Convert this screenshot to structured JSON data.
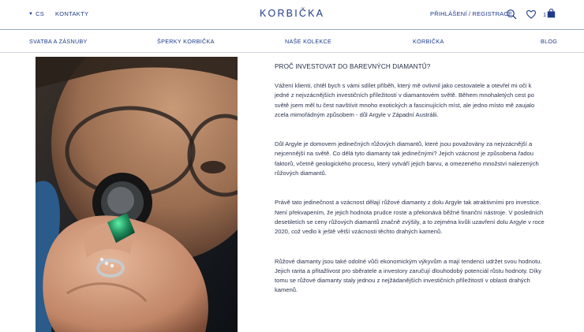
{
  "header": {
    "language": "CS",
    "contacts": "KONTAKTY",
    "logo": "KORBIČKA",
    "login": "PŘIHLÁŠENÍ / REGISTRACE",
    "cart_count": "1",
    "icons": [
      "search-icon",
      "heart-icon",
      "shopping-bag-icon"
    ]
  },
  "nav": {
    "items": [
      {
        "label": "SVATBA A ZÁSNUBY"
      },
      {
        "label": "ŠPERKY KORBIČKA"
      },
      {
        "label": "NAŠE KOLEKCE"
      },
      {
        "label": "KORBIČKA"
      },
      {
        "label": "BLOG"
      }
    ]
  },
  "article": {
    "title": "PROČ INVESTOVAT DO BAREVNÝCH DIAMANTŮ?",
    "paragraphs": [
      "Vážení klienti, chtěl bych s vámi sdílet příběh, který mě ovlivnil jako cestovatele a otevřel mi oči k jedné z nejvzácnějších investičních příležitostí v diamantovém světě. Během mnohaletých cest po světě jsem měl tu čest navštívit mnoho exotických a fascinujících míst, ale jedno místo mě zaujalo zcela mimořádným způsobem - důl Argyle v Západní Austrálii.",
      "Důl Argyle je domovem jedinečných růžových diamantů, které jsou považovány za nejvzácnější a nejcennější na světě. Co dělá tyto diamanty tak jedinečnými? Jejich vzácnost je způsobena řadou faktorů, včetně geologického procesu, který vytváří jejich barvu, a omezeného množství nalezených růžových diamantů.",
      "Právě tato jedinečnost a vzácnost dělají růžové diamanty z dolu Argyle tak atraktivními pro investice. Není překvapením, že jejich hodnota prudce roste a překonává běžné finanční nástroje. V posledních desetiletích se ceny růžových diamantů značně zvýšily, a to zejména kvůli uzavření dolu Argyle v roce 2020, což vedlo k ještě větší vzácnosti těchto drahých kamenů.",
      "Růžové diamanty jsou také odolné vůči ekonomickým výkyvům a mají tendenci udržet svou hodnotu. Jejich rarita a přitažlivost pro sběratele a investory zaručují dlouhodobý potenciál růstu hodnoty. Díky tomu se růžové diamanty staly jednou z nejžádanějších investičních příležitostí v oblasti drahých kamenů."
    ]
  },
  "colors": {
    "brand": "#1f3a8a",
    "text": "#2d3550",
    "gem": "#1d8a5a"
  }
}
